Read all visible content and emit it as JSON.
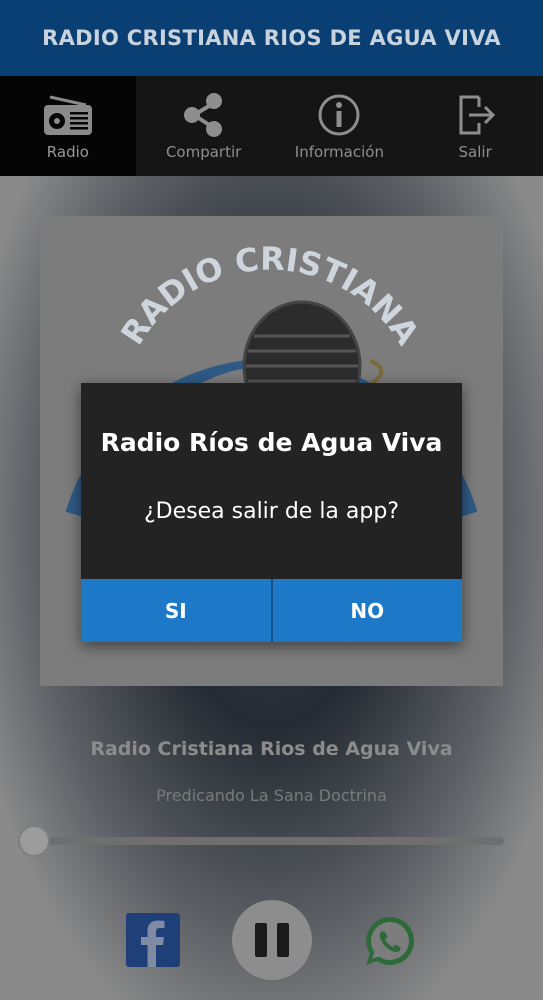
{
  "header": {
    "title": "RADIO CRISTIANA RIOS DE AGUA VIVA"
  },
  "tabs": [
    {
      "label": "Radio",
      "icon": "radio-icon",
      "active": true
    },
    {
      "label": "Compartir",
      "icon": "share-icon",
      "active": false
    },
    {
      "label": "Información",
      "icon": "info-icon",
      "active": false
    },
    {
      "label": "Salir",
      "icon": "exit-icon",
      "active": false
    }
  ],
  "cover": {
    "logo_text": "RADIO CRISTIANA"
  },
  "player": {
    "station_name": "Radio Cristiana Rios de Agua Viva",
    "slogan": "Predicando La Sana Doctrina",
    "volume_fraction": 0.0,
    "state": "playing"
  },
  "controls": {
    "facebook": "facebook-icon",
    "pause": "pause-icon",
    "whatsapp": "whatsapp-icon"
  },
  "dialog": {
    "title": "Radio Ríos de Agua Viva",
    "message": "¿Desea salir de la app?",
    "yes_label": "SI",
    "no_label": "NO"
  },
  "colors": {
    "header_bg": "#0a3f73",
    "dialog_button": "#1e78c8",
    "dialog_bg": "#232323"
  }
}
